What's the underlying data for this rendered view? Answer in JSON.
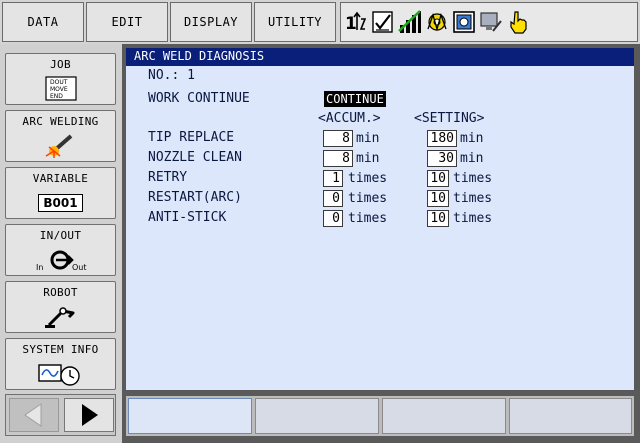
{
  "menu": {
    "data": "DATA",
    "edit": "EDIT",
    "display": "DISPLAY",
    "utility": "UTILITY"
  },
  "status_icons": [
    "sort-icon",
    "edit-check-icon",
    "signal-bars-icon",
    "weld-gear-icon",
    "panel-icon",
    "monitor-pen-icon",
    "hand-pointer-icon"
  ],
  "sidebar": {
    "job": {
      "label": "JOB",
      "icon_lines": [
        "DOUT",
        "MOVE",
        "END"
      ]
    },
    "arc_welding": {
      "label": "ARC WELDING"
    },
    "variable": {
      "label": "VARIABLE",
      "badge": "B001"
    },
    "in_out": {
      "label": "IN/OUT",
      "in": "In",
      "out": "Out"
    },
    "robot": {
      "label": "ROBOT"
    },
    "system_info": {
      "label": "SYSTEM INFO"
    }
  },
  "screen": {
    "title": "ARC WELD DIAGNOSIS",
    "number_label": "NO.: 1",
    "work_continue_label": "WORK CONTINUE",
    "work_continue_value": "CONTINUE",
    "accum_header": "<ACCUM.>",
    "setting_header": "<SETTING>",
    "rows": [
      {
        "label": "TIP REPLACE",
        "accum": "8",
        "accum_unit": "min",
        "setting": "180",
        "setting_unit": "min"
      },
      {
        "label": "NOZZLE CLEAN",
        "accum": "8",
        "accum_unit": "min",
        "setting": "30",
        "setting_unit": "min"
      },
      {
        "label": "RETRY",
        "accum": "1",
        "accum_unit": "times",
        "setting": "10",
        "setting_unit": "times"
      },
      {
        "label": "RESTART(ARC)",
        "accum": "0",
        "accum_unit": "times",
        "setting": "10",
        "setting_unit": "times"
      },
      {
        "label": "ANTI-STICK",
        "accum": "0",
        "accum_unit": "times",
        "setting": "10",
        "setting_unit": "times"
      }
    ]
  },
  "colors": {
    "title_bg": "#0a1f7a",
    "content_bg": "#dce7fb",
    "text": "#0a1840"
  }
}
